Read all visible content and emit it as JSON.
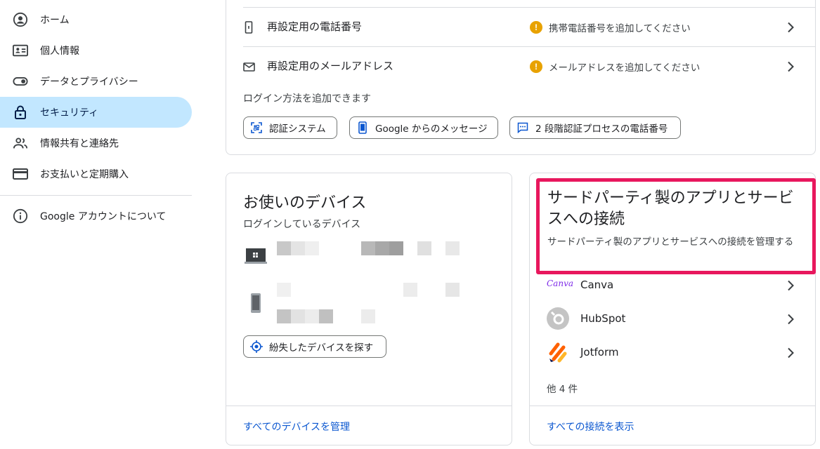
{
  "sidebar": {
    "items": [
      {
        "label": "ホーム",
        "icon": "account-circle-icon"
      },
      {
        "label": "個人情報",
        "icon": "id-card-icon"
      },
      {
        "label": "データとプライバシー",
        "icon": "toggle-icon"
      },
      {
        "label": "セキュリティ",
        "icon": "lock-icon",
        "active": true
      },
      {
        "label": "情報共有と連絡先",
        "icon": "people-icon"
      },
      {
        "label": "お支払いと定期購入",
        "icon": "credit-card-icon"
      }
    ],
    "about": {
      "label": "Google アカウントについて",
      "icon": "info-icon"
    }
  },
  "recovery": {
    "phone": {
      "label": "再設定用の電話番号",
      "status": "携帯電話番号を追加してください"
    },
    "email": {
      "label": "再設定用のメールアドレス",
      "status": "メールアドレスを追加してください"
    },
    "add_methods_text": "ログイン方法を追加できます",
    "chips": [
      {
        "label": "認証システム",
        "icon": "qr-scan-icon"
      },
      {
        "label": "Google からのメッセージ",
        "icon": "phone-icon"
      },
      {
        "label": "2 段階認証プロセスの電話番号",
        "icon": "sms-icon"
      }
    ]
  },
  "devices": {
    "title": "お使いのデバイス",
    "subtitle": "ログインしているデバイス",
    "find_button": "紛失したデバイスを探す",
    "manage_link": "すべてのデバイスを管理"
  },
  "third_party": {
    "title": "サードパーティ製のアプリとサービスへの接続",
    "description": "サードパーティ製のアプリとサービスへの接続を管理する",
    "apps": [
      {
        "name": "Canva",
        "logo_text": "Canva"
      },
      {
        "name": "HubSpot"
      },
      {
        "name": "Jotform"
      }
    ],
    "more_text": "他 4 件",
    "view_all_link": "すべての接続を表示"
  },
  "colors": {
    "accent": "#0b57d0",
    "highlight": "#e8175d",
    "active_nav": "#c2e7ff",
    "warning": "#e8a200"
  }
}
